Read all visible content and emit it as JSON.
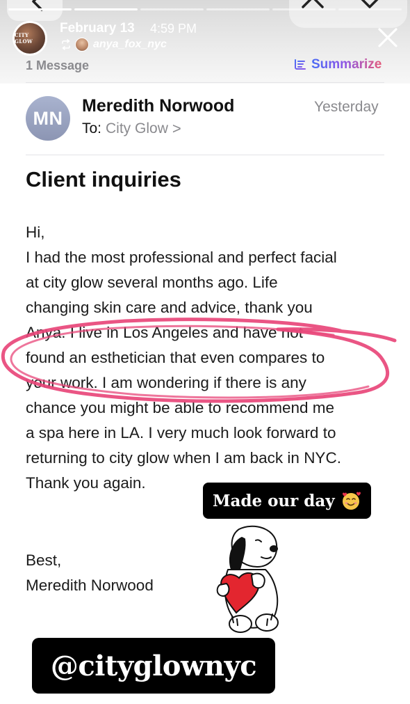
{
  "story": {
    "date": "February 13",
    "time": "4:59 PM",
    "reposted_from": "anya_fox_nyc",
    "account_avatar_text": "CITY GLOW",
    "progress_segments": 6,
    "progress_done": 2
  },
  "mail": {
    "message_count": "1 Message",
    "summarize_label": "Summarize",
    "sender_initials": "MN",
    "sender_name": "Meredith Norwood",
    "to_label": "To:",
    "to_value": "City Glow",
    "to_chevron": ">",
    "date": "Yesterday",
    "subject": "Client inquiries",
    "body_lines": [
      "Hi,",
      "I had the most professional and perfect facial",
      "at city glow several months ago. Life",
      "changing skin care and advice, thank you",
      "Anya.  I live in Los Angeles and have not",
      "found an esthetician that even compares to",
      "your work. I am wondering if there is any",
      "chance you might be able to recommend me",
      "a spa here in LA. I very much look forward to",
      "returning to city glow when I am back in NYC.",
      "Thank you again."
    ],
    "signoff_lines": [
      "Best,",
      "Meredith Norwood"
    ]
  },
  "stickers": {
    "day_text": "Made our day",
    "day_emoji": "smiling-face-with-hearts-icon",
    "handle": "@cityglownyc",
    "character": "snoopy-hugging-heart"
  },
  "colors": {
    "highlight": "#e8477a",
    "summarize_gradient": [
      "#4a6df5",
      "#8b56e8",
      "#e45a7a"
    ],
    "sender_avatar": "#9aa3c2",
    "muted_text": "#8a8a8e"
  }
}
